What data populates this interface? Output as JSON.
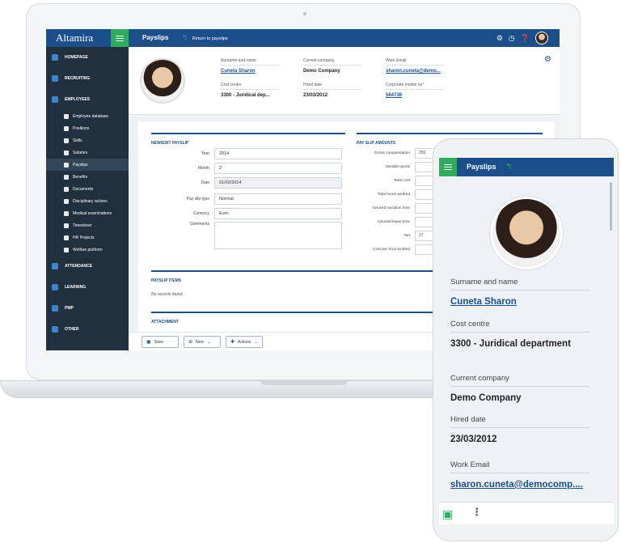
{
  "app": {
    "brand": "Altamira",
    "title": "Payslips",
    "back_label": "Return to payslips"
  },
  "sidebar": {
    "items": [
      {
        "label": "HOMEPAGE",
        "type": "main"
      },
      {
        "label": "RECRUITING",
        "type": "main"
      },
      {
        "label": "EMPLOYEES",
        "type": "main"
      },
      {
        "label": "Employee database",
        "type": "sub"
      },
      {
        "label": "Positions",
        "type": "sub"
      },
      {
        "label": "Skills",
        "type": "sub"
      },
      {
        "label": "Salaries",
        "type": "sub"
      },
      {
        "label": "Payslips",
        "type": "sub",
        "active": true
      },
      {
        "label": "Benefits",
        "type": "sub"
      },
      {
        "label": "Documents",
        "type": "sub"
      },
      {
        "label": "Disciplinary actions",
        "type": "sub"
      },
      {
        "label": "Medical examinations",
        "type": "sub"
      },
      {
        "label": "Timesheet",
        "type": "sub"
      },
      {
        "label": "HR Projects",
        "type": "sub"
      },
      {
        "label": "Wolfare platform",
        "type": "sub"
      },
      {
        "label": "ATTENDANCE",
        "type": "main"
      },
      {
        "label": "LEARNING",
        "type": "main"
      },
      {
        "label": "PMP",
        "type": "main"
      },
      {
        "label": "OTHER",
        "type": "main"
      }
    ]
  },
  "profile": {
    "surname_label": "Surname and name",
    "surname": "Cuneta Sharon",
    "company_label": "Current company",
    "company": "Demo Company",
    "email_label": "Work Email",
    "email": "sharon.cuneta@demo...",
    "cost_label": "Cost centre",
    "cost": "3300 - Juridical dep...",
    "hired_label": "Hired date",
    "hired": "23/03/2012",
    "mobile_label": "Corporate mobile no°",
    "mobile": "564738"
  },
  "payslip_form": {
    "title": "NEW/EDIT PAYSLIP",
    "year_label": "Year",
    "year": "2014",
    "month_label": "Month",
    "month": "2",
    "date_label": "Date",
    "date": "01/02/2014",
    "type_label": "Pay slip type",
    "type": "Normal",
    "currency_label": "Currency",
    "currency": "Euro",
    "comments_label": "Comments"
  },
  "amounts": {
    "title": "PAY SLIP AMOUNTS",
    "gross_label": "Gross compensation",
    "gross": "250",
    "variable_label": "Variable gross",
    "total_cost_label": "Total cost",
    "hours_label": "Total hours worked",
    "vacation_label": "Unused vacation time",
    "leave_label": "Unused leave time",
    "net_label": "Net",
    "net": "17",
    "cost_hour_label": "Cost per hour worked"
  },
  "items": {
    "title": "PAYSLIP ITEMS",
    "empty": "No records found"
  },
  "attachment": {
    "title": "ATTACHMENT"
  },
  "actions": {
    "save": "Save",
    "new": "New",
    "actions": "Actions"
  },
  "phone": {
    "title": "Payslips",
    "surname_label": "Surname and name",
    "surname": "Cuneta Sharon",
    "cost_label": "Cost centre",
    "cost": "3300 - Juridical department",
    "company_label": "Current company",
    "company": "Demo Company",
    "hired_label": "Hired date",
    "hired": "23/03/2012",
    "email_label": "Work Email",
    "email": "sharon.cuneta@democomp...."
  },
  "colors": {
    "primary": "#1b4f8c",
    "accent": "#2eae5c",
    "sidebar": "#20303f"
  }
}
